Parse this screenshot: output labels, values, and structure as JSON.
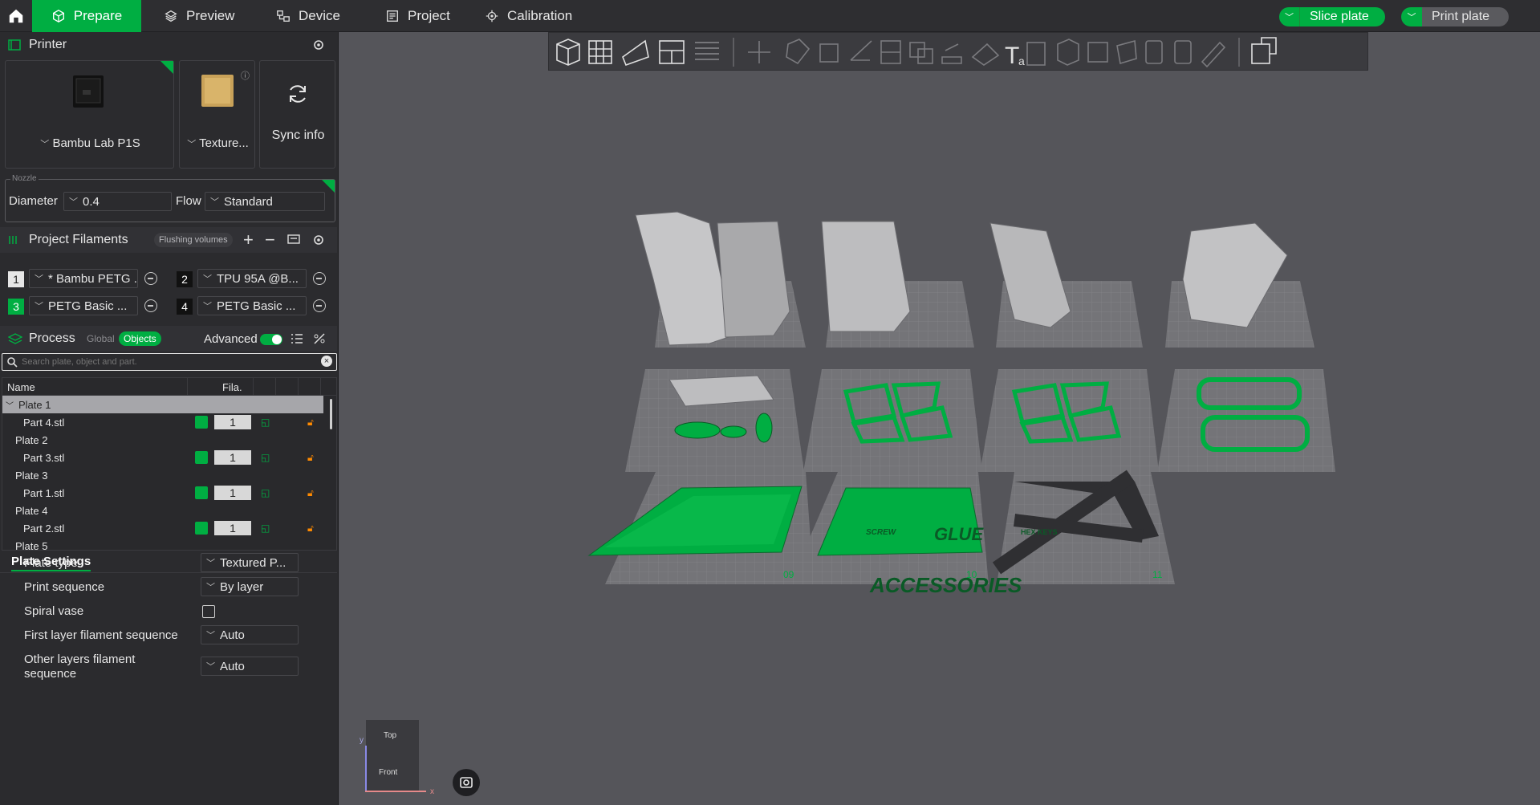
{
  "topbar": {
    "tabs": [
      {
        "label": "Prepare",
        "icon": "cube-icon",
        "active": true
      },
      {
        "label": "Preview",
        "icon": "layers-icon"
      },
      {
        "label": "Device",
        "icon": "device-icon"
      },
      {
        "label": "Project",
        "icon": "project-icon"
      },
      {
        "label": "Calibration",
        "icon": "calibration-icon"
      }
    ],
    "slice_label": "Slice plate",
    "print_label": "Print plate"
  },
  "printer": {
    "title": "Printer",
    "printer_name": "Bambu Lab P1S",
    "plate_name": "Texture...",
    "sync_label": "Sync info",
    "nozzle_legend": "Nozzle",
    "diameter_label": "Diameter",
    "diameter_value": "0.4",
    "flow_label": "Flow",
    "flow_value": "Standard"
  },
  "filaments": {
    "title": "Project Filaments",
    "flushing_label": "Flushing volumes",
    "items": [
      {
        "num": "1",
        "name": "* Bambu PETG ...",
        "color": "#ffffff"
      },
      {
        "num": "2",
        "name": "TPU 95A @B...",
        "color": "#111111"
      },
      {
        "num": "3",
        "name": "PETG Basic ...",
        "color": "#00ae42"
      },
      {
        "num": "4",
        "name": "PETG Basic ...",
        "color": "#111111"
      }
    ]
  },
  "process": {
    "title": "Process",
    "global_label": "Global",
    "objects_label": "Objects",
    "advanced_label": "Advanced",
    "search_placeholder": "Search plate, object and part."
  },
  "tree": {
    "col_name": "Name",
    "col_fila": "Fila.",
    "rows": [
      {
        "label": "Plate 1",
        "type": "plate",
        "selected": true
      },
      {
        "label": "Part 4.stl",
        "type": "part",
        "fila": "1"
      },
      {
        "label": "Plate 2",
        "type": "plate"
      },
      {
        "label": "Part 3.stl",
        "type": "part",
        "fila": "1"
      },
      {
        "label": "Plate 3",
        "type": "plate"
      },
      {
        "label": "Part 1.stl",
        "type": "part",
        "fila": "1"
      },
      {
        "label": "Plate 4",
        "type": "plate"
      },
      {
        "label": "Part 2.stl",
        "type": "part",
        "fila": "1"
      },
      {
        "label": "Plate 5",
        "type": "plate"
      }
    ]
  },
  "plate_settings": {
    "title": "Plate Settings",
    "rows": [
      {
        "label": "Plate type",
        "value": "Textured P..."
      },
      {
        "label": "Print sequence",
        "value": "By layer"
      },
      {
        "label": "Spiral vase",
        "value": ""
      },
      {
        "label": "First layer filament sequence",
        "value": "Auto"
      },
      {
        "label": "Other layers filament sequence",
        "value": "Auto"
      }
    ]
  },
  "viewport": {
    "plate_numbers": [
      "09",
      "10",
      "11"
    ],
    "model_texts": [
      "GLUE",
      "ACCESSORIES",
      "SCREW",
      "HEX KEYS"
    ],
    "cube_top": "Top",
    "cube_front": "Front",
    "axis_y": "y",
    "axis_x": "x"
  },
  "colors": {
    "accent": "#00ae42",
    "panel": "#2b2b2e",
    "viewport": "#55555a"
  }
}
